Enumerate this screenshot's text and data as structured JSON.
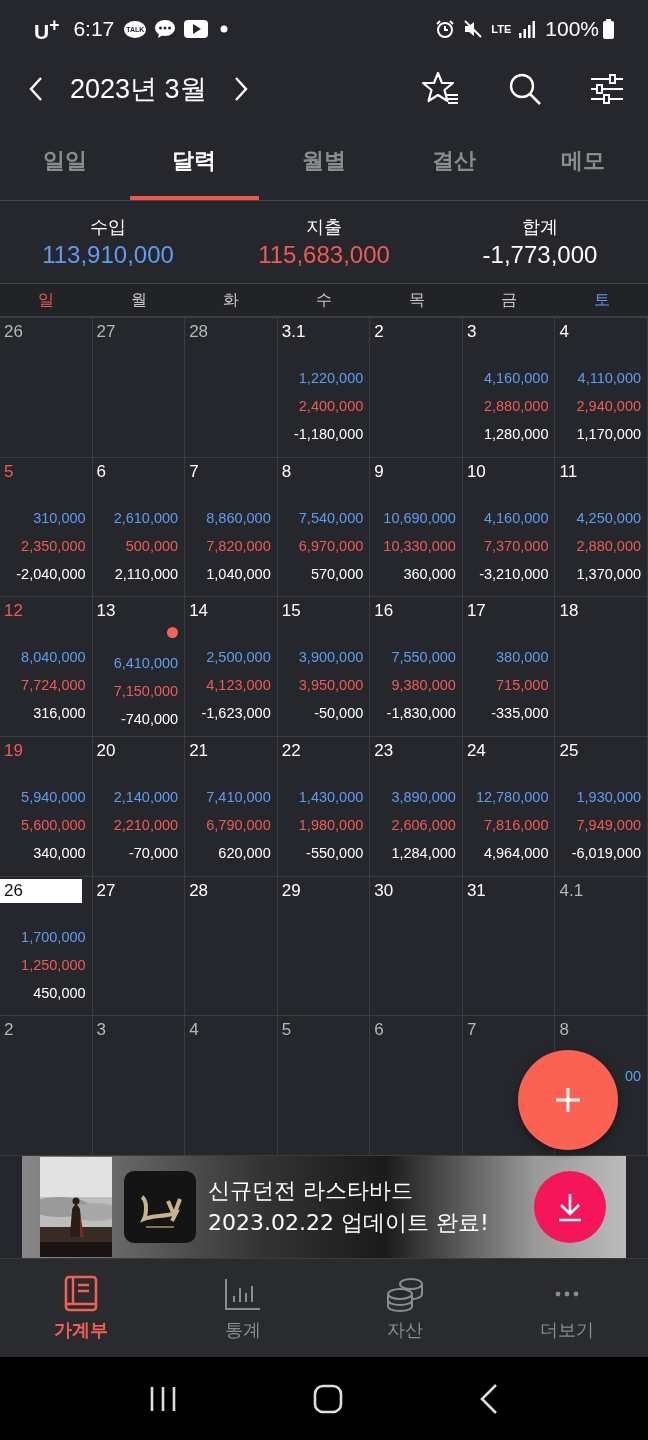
{
  "status_bar": {
    "carrier": "U$^{+}$",
    "time": "6:17",
    "kakao_label": "TALK",
    "network": "LTE",
    "battery": "100%"
  },
  "header": {
    "title": "2023년 3월"
  },
  "tabs": [
    {
      "label": "일일",
      "selected": false
    },
    {
      "label": "달력",
      "selected": true
    },
    {
      "label": "월별",
      "selected": false
    },
    {
      "label": "결산",
      "selected": false
    },
    {
      "label": "메모",
      "selected": false
    }
  ],
  "summary": [
    {
      "label": "수입",
      "value": "113,910,000",
      "kind": "income"
    },
    {
      "label": "지출",
      "value": "115,683,000",
      "kind": "expense"
    },
    {
      "label": "합계",
      "value": "-1,773,000",
      "kind": "total"
    }
  ],
  "weekdays": [
    "일",
    "월",
    "화",
    "수",
    "목",
    "금",
    "토"
  ],
  "weeks": [
    [
      {
        "day": "26",
        "in_month": false
      },
      {
        "day": "27",
        "in_month": false
      },
      {
        "day": "28",
        "in_month": false
      },
      {
        "day": "3.1",
        "in_month": true,
        "income": "1,220,000",
        "expense": "2,400,000",
        "total": "-1,180,000"
      },
      {
        "day": "2",
        "in_month": true
      },
      {
        "day": "3",
        "in_month": true,
        "income": "4,160,000",
        "expense": "2,880,000",
        "total": "1,280,000"
      },
      {
        "day": "4",
        "in_month": true,
        "income": "4,110,000",
        "expense": "2,940,000",
        "total": "1,170,000"
      }
    ],
    [
      {
        "day": "5",
        "in_month": true,
        "income": "310,000",
        "expense": "2,350,000",
        "total": "-2,040,000"
      },
      {
        "day": "6",
        "in_month": true,
        "income": "2,610,000",
        "expense": "500,000",
        "total": "2,110,000"
      },
      {
        "day": "7",
        "in_month": true,
        "income": "8,860,000",
        "expense": "7,820,000",
        "total": "1,040,000"
      },
      {
        "day": "8",
        "in_month": true,
        "income": "7,540,000",
        "expense": "6,970,000",
        "total": "570,000"
      },
      {
        "day": "9",
        "in_month": true,
        "income": "10,690,000",
        "expense": "10,330,000",
        "total": "360,000"
      },
      {
        "day": "10",
        "in_month": true,
        "income": "4,160,000",
        "expense": "7,370,000",
        "total": "-3,210,000"
      },
      {
        "day": "11",
        "in_month": true,
        "income": "4,250,000",
        "expense": "2,880,000",
        "total": "1,370,000"
      }
    ],
    [
      {
        "day": "12",
        "in_month": true,
        "income": "8,040,000",
        "expense": "7,724,000",
        "total": "316,000"
      },
      {
        "day": "13",
        "in_month": true,
        "memo": true,
        "income": "6,410,000",
        "expense": "7,150,000",
        "total": "-740,000"
      },
      {
        "day": "14",
        "in_month": true,
        "income": "2,500,000",
        "expense": "4,123,000",
        "total": "-1,623,000"
      },
      {
        "day": "15",
        "in_month": true,
        "income": "3,900,000",
        "expense": "3,950,000",
        "total": "-50,000"
      },
      {
        "day": "16",
        "in_month": true,
        "income": "7,550,000",
        "expense": "9,380,000",
        "total": "-1,830,000"
      },
      {
        "day": "17",
        "in_month": true,
        "income": "380,000",
        "expense": "715,000",
        "total": "-335,000"
      },
      {
        "day": "18",
        "in_month": true
      }
    ],
    [
      {
        "day": "19",
        "in_month": true,
        "income": "5,940,000",
        "expense": "5,600,000",
        "total": "340,000"
      },
      {
        "day": "20",
        "in_month": true,
        "income": "2,140,000",
        "expense": "2,210,000",
        "total": "-70,000"
      },
      {
        "day": "21",
        "in_month": true,
        "income": "7,410,000",
        "expense": "6,790,000",
        "total": "620,000"
      },
      {
        "day": "22",
        "in_month": true,
        "income": "1,430,000",
        "expense": "1,980,000",
        "total": "-550,000"
      },
      {
        "day": "23",
        "in_month": true,
        "income": "3,890,000",
        "expense": "2,606,000",
        "total": "1,284,000"
      },
      {
        "day": "24",
        "in_month": true,
        "income": "12,780,000",
        "expense": "7,816,000",
        "total": "4,964,000"
      },
      {
        "day": "25",
        "in_month": true,
        "income": "1,930,000",
        "expense": "7,949,000",
        "total": "-6,019,000"
      }
    ],
    [
      {
        "day": "26",
        "in_month": true,
        "today": true,
        "income": "1,700,000",
        "expense": "1,250,000",
        "total": "450,000"
      },
      {
        "day": "27",
        "in_month": true
      },
      {
        "day": "28",
        "in_month": true
      },
      {
        "day": "29",
        "in_month": true
      },
      {
        "day": "30",
        "in_month": true
      },
      {
        "day": "31",
        "in_month": true
      },
      {
        "day": "4.1",
        "in_month": false
      }
    ],
    [
      {
        "day": "2",
        "in_month": false
      },
      {
        "day": "3",
        "in_month": false
      },
      {
        "day": "4",
        "in_month": false
      },
      {
        "day": "5",
        "in_month": false
      },
      {
        "day": "6",
        "in_month": false
      },
      {
        "day": "7",
        "in_month": false
      },
      {
        "day": "8",
        "in_month": false,
        "income": "00"
      }
    ]
  ],
  "ad": {
    "lines": [
      "신규던전 라스타바드",
      "2023.02.22 업데이트 완료!"
    ]
  },
  "bottom_nav": [
    {
      "label": "가계부",
      "selected": true
    },
    {
      "label": "통계",
      "selected": false
    },
    {
      "label": "자산",
      "selected": false
    },
    {
      "label": "더보기",
      "selected": false
    }
  ]
}
